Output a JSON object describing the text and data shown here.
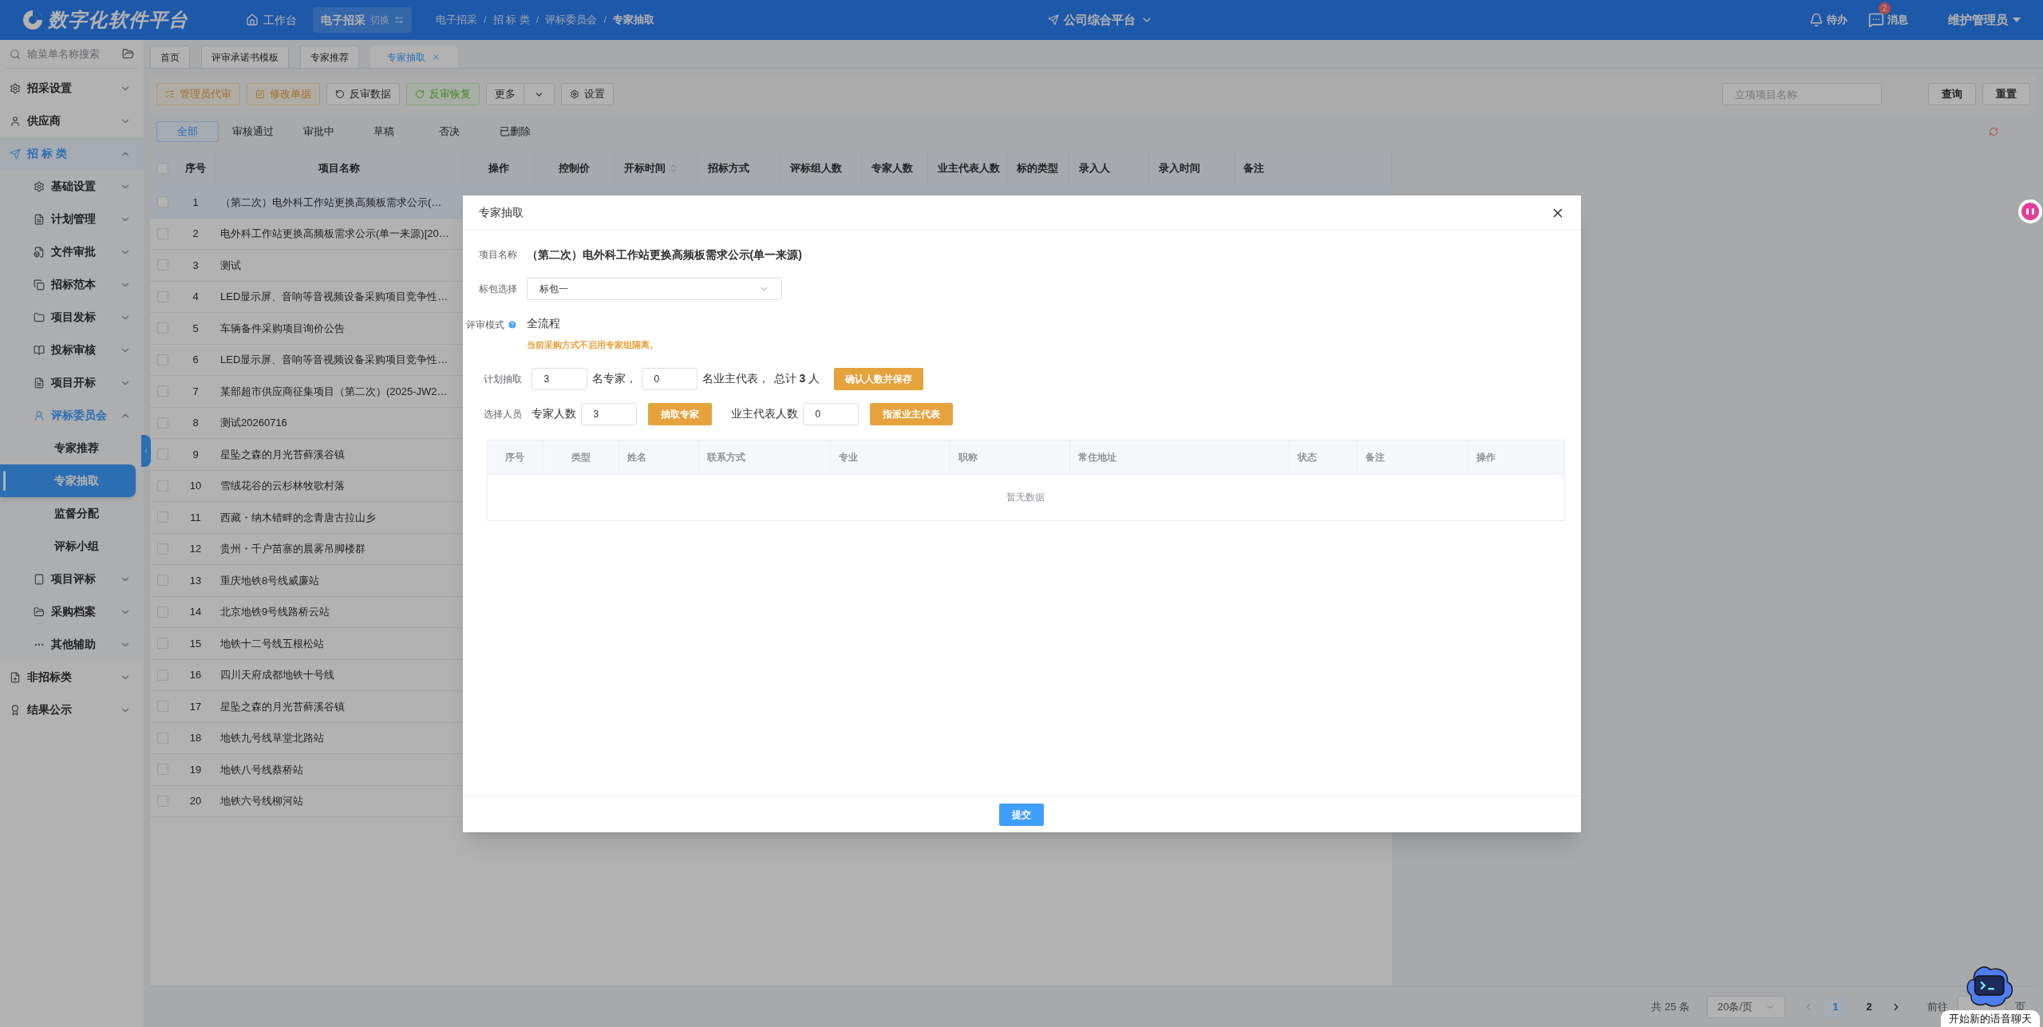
{
  "header": {
    "logo_text": "数字化软件平台",
    "workbench": "工作台",
    "system": {
      "label": "电子招采",
      "switch": "切换",
      "selected": true
    },
    "breadcrumb_separator": "/",
    "breadcrumb": [
      "电子招采",
      "招 标 类",
      "评标委员会",
      "专家抽取"
    ],
    "platform": "公司综合平台",
    "todo": "待办",
    "messages": {
      "label": "消息",
      "badge": "2"
    },
    "user": "维护管理员"
  },
  "sidebar": {
    "search_placeholder": "输菜单名称搜索",
    "items": [
      {
        "label": "招采设置",
        "expanded": false,
        "selected": false
      },
      {
        "label": "供应商",
        "expanded": false,
        "selected": false
      },
      {
        "label": "招 标 类",
        "expanded": true,
        "selected": false,
        "children": [
          {
            "label": "基础设置",
            "expanded": false,
            "selected": false
          },
          {
            "label": "计划管理",
            "expanded": false,
            "selected": false
          },
          {
            "label": "文件审批",
            "expanded": false,
            "selected": false
          },
          {
            "label": "招标范本",
            "expanded": false,
            "selected": false
          },
          {
            "label": "项目发标",
            "expanded": false,
            "selected": false
          },
          {
            "label": "投标审核",
            "expanded": false,
            "selected": false
          },
          {
            "label": "项目开标",
            "expanded": false,
            "selected": false
          },
          {
            "label": "评标委员会",
            "expanded": true,
            "selected": false,
            "children": [
              {
                "label": "专家推荐",
                "selected": false
              },
              {
                "label": "专家抽取",
                "selected": true
              },
              {
                "label": "监督分配",
                "selected": false
              },
              {
                "label": "评标小组",
                "selected": false
              }
            ]
          },
          {
            "label": "项目评标",
            "expanded": false,
            "selected": false
          },
          {
            "label": "采购档案",
            "expanded": false,
            "selected": false
          },
          {
            "label": "其他辅助",
            "expanded": false,
            "selected": false
          }
        ]
      },
      {
        "label": "非招标类",
        "expanded": false,
        "selected": false
      },
      {
        "label": "结果公示",
        "expanded": false,
        "selected": false
      }
    ]
  },
  "page_tabs": [
    {
      "label": "首页",
      "selected": false,
      "closable": false
    },
    {
      "label": "评审承诺书模板",
      "selected": false,
      "closable": false
    },
    {
      "label": "专家推荐",
      "selected": false,
      "closable": false
    },
    {
      "label": "专家抽取",
      "selected": true,
      "closable": true
    }
  ],
  "toolbar": [
    {
      "label": "管理员代审",
      "kind": "warning"
    },
    {
      "label": "修改单据",
      "kind": "warning"
    },
    {
      "label": "反审数据",
      "kind": "default"
    },
    {
      "label": "反审恢复",
      "kind": "success"
    },
    {
      "label": "更多",
      "kind": "dropdown"
    },
    {
      "label": "设置",
      "kind": "default"
    }
  ],
  "search": {
    "placeholder": "立项项目名称",
    "buttons": [
      "查询",
      "重置"
    ]
  },
  "status_tabs": [
    {
      "label": "全部",
      "selected": true
    },
    {
      "label": "审核通过",
      "selected": false
    },
    {
      "label": "审批中",
      "selected": false
    },
    {
      "label": "草稿",
      "selected": false
    },
    {
      "label": "否决",
      "selected": false
    },
    {
      "label": "已删除",
      "selected": false
    }
  ],
  "table": {
    "select_all_checked": false,
    "columns": [
      {
        "label": "序号",
        "sortable": false
      },
      {
        "label": "项目名称",
        "sortable": false
      },
      {
        "label": "操作",
        "sortable": false
      },
      {
        "label": "控制价",
        "sortable": false
      },
      {
        "label": "开标时间",
        "sortable": true
      },
      {
        "label": "招标方式",
        "sortable": false
      },
      {
        "label": "评标组人数",
        "sortable": false
      },
      {
        "label": "专家人数",
        "sortable": false
      },
      {
        "label": "业主代表人数",
        "sortable": false
      },
      {
        "label": "标的类型",
        "sortable": false
      },
      {
        "label": "录入人",
        "sortable": false
      },
      {
        "label": "录入时间",
        "sortable": false
      },
      {
        "label": "备注",
        "sortable": false
      }
    ],
    "rows": [
      {
        "no": "1",
        "name": "（第二次）电外科工作站更换高频板需求公示(…",
        "checked": false,
        "selected": true
      },
      {
        "no": "2",
        "name": "电外科工作站更换高频板需求公示(单一来源)[20…",
        "checked": false,
        "selected": false
      },
      {
        "no": "3",
        "name": "测试",
        "checked": false,
        "selected": false
      },
      {
        "no": "4",
        "name": "LED显示屏、音响等音视频设备采购项目竞争性…",
        "checked": false,
        "selected": false
      },
      {
        "no": "5",
        "name": "车辆备件采购项目询价公告",
        "checked": false,
        "selected": false
      },
      {
        "no": "6",
        "name": "LED显示屏、音响等音视频设备采购项目竞争性…",
        "checked": false,
        "selected": false
      },
      {
        "no": "7",
        "name": "某部超市供应商征集项目（第二次）(2025-JW2…",
        "checked": false,
        "selected": false
      },
      {
        "no": "8",
        "name": "测试20260716",
        "checked": false,
        "selected": false
      },
      {
        "no": "9",
        "name": "星坠之森的月光苔藓溪谷镇",
        "checked": false,
        "selected": false
      },
      {
        "no": "10",
        "name": "雪绒花谷的云杉林牧歌村落",
        "checked": false,
        "selected": false
      },
      {
        "no": "11",
        "name": "西藏・纳木错畔的念青唐古拉山乡",
        "checked": false,
        "selected": false
      },
      {
        "no": "12",
        "name": "贵州・千户苗寨的晨雾吊脚楼群",
        "checked": false,
        "selected": false
      },
      {
        "no": "13",
        "name": "重庆地铁8号线威廉站",
        "checked": false,
        "selected": false
      },
      {
        "no": "14",
        "name": "北京地铁9号线路桥云站",
        "checked": false,
        "selected": false
      },
      {
        "no": "15",
        "name": "地铁十二号线五根松站",
        "checked": false,
        "selected": false
      },
      {
        "no": "16",
        "name": "四川天府成都地铁十号线",
        "checked": false,
        "selected": false
      },
      {
        "no": "17",
        "name": "星坠之森的月光苔藓溪谷镇",
        "checked": false,
        "selected": false
      },
      {
        "no": "18",
        "name": "地铁九号线草堂北路站",
        "checked": false,
        "selected": false
      },
      {
        "no": "19",
        "name": "地铁八号线蔡桥站",
        "checked": false,
        "selected": false
      },
      {
        "no": "20",
        "name": "地铁六号线柳河站",
        "checked": false,
        "selected": false
      }
    ]
  },
  "pagination": {
    "total": "共 25 条",
    "page_size": "20条/页",
    "pages": [
      {
        "label": "1",
        "selected": true
      },
      {
        "label": "2",
        "selected": false
      }
    ],
    "goto_prefix": "前往",
    "goto_suffix": "页"
  },
  "modal": {
    "title": "专家抽取",
    "project": {
      "label": "项目名称",
      "value": "（第二次）电外科工作站更换高频板需求公示(单一来源)"
    },
    "package": {
      "label": "标包选择",
      "value": "标包一"
    },
    "review_mode": {
      "label": "评审模式",
      "value": "全流程",
      "hint": "当前采购方式不启用专家组隔离。"
    },
    "plan": {
      "label": "计划抽取",
      "experts": "3",
      "experts_suffix": "名专家，",
      "owners": "0",
      "owners_suffix": "名业主代表，",
      "total": "总计 **3** 人",
      "button": "确认人数并保存"
    },
    "select": {
      "label": "选择人员",
      "experts_label": "专家人数",
      "experts": "3",
      "experts_button": "抽取专家",
      "owners_label": "业主代表人数",
      "owners": "0",
      "owners_button": "指派业主代表"
    },
    "table": {
      "columns": [
        "序号",
        "类型",
        "姓名",
        "联系方式",
        "专业",
        "职称",
        "常住地址",
        "状态",
        "备注",
        "操作"
      ],
      "empty": "暂无数据"
    },
    "submit": "提交"
  },
  "assistant": {
    "bubble": "开始新的语音聊天"
  }
}
